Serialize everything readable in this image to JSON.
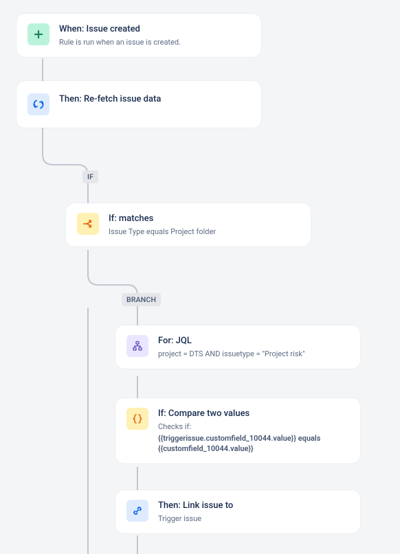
{
  "labels": {
    "if": "IF",
    "branch": "BRANCH"
  },
  "cards": {
    "trigger": {
      "title": "When: Issue created",
      "subtitle": "Rule is run when an issue is created."
    },
    "refetch": {
      "title": "Then: Re-fetch issue data"
    },
    "ifMatches": {
      "title": "If: matches",
      "subtitle": "Issue Type equals Project folder"
    },
    "forJql": {
      "title": "For: JQL",
      "subtitle": "project = DTS AND issuetype = \"Project risk\""
    },
    "compare": {
      "title": "If: Compare two values",
      "sub1": "Checks if:",
      "sub2": "{{triggerissue.customfield_10044.value}} equals {{customfield_10044.value}}"
    },
    "link": {
      "title": "Then: Link issue to",
      "subtitle": "Trigger issue"
    }
  }
}
